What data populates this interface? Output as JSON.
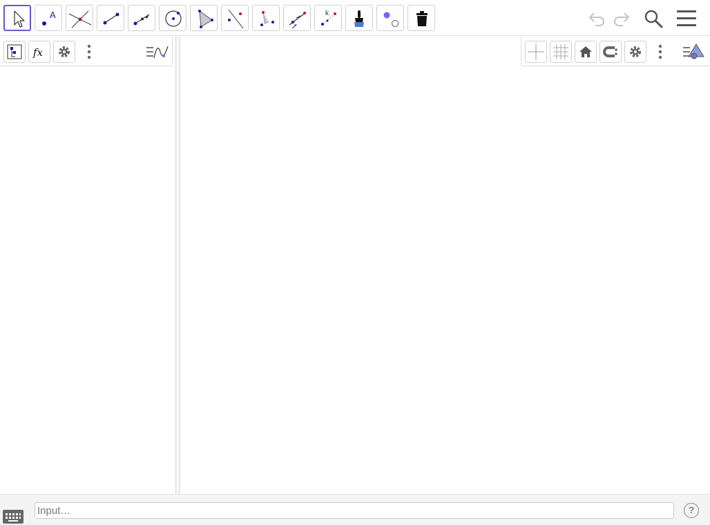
{
  "toolbar": {
    "tools": [
      {
        "name": "move-tool",
        "icon": "arrow-cursor-icon",
        "selected": true
      },
      {
        "name": "point-tool",
        "icon": "point-icon",
        "label": "A"
      },
      {
        "name": "intersect-tool",
        "icon": "intersect-icon"
      },
      {
        "name": "segment-tool",
        "icon": "segment-icon"
      },
      {
        "name": "perpendicular-tool",
        "icon": "perpendicular-icon"
      },
      {
        "name": "circle-tool",
        "icon": "circle-center-point-icon"
      },
      {
        "name": "polygon-tool",
        "icon": "polygon-icon"
      },
      {
        "name": "line-tool",
        "icon": "line-icon"
      },
      {
        "name": "angle-tool",
        "icon": "angle-icon"
      },
      {
        "name": "reflect-tool",
        "icon": "reflect-icon"
      },
      {
        "name": "text-slider-tool",
        "icon": "slider-icon",
        "label": "k"
      },
      {
        "name": "style-brush-tool",
        "icon": "paint-brush-icon"
      },
      {
        "name": "show-hide-tool",
        "icon": "show-hide-object-icon"
      },
      {
        "name": "delete-tool",
        "icon": "trash-icon"
      }
    ],
    "right_icons": [
      "undo-icon",
      "redo-icon",
      "search-icon",
      "hamburger-menu-icon"
    ]
  },
  "algebra": {
    "buttons": [
      "algebra-tree-icon",
      "fx-icon",
      "gear-icon",
      "more-vert-icon",
      "graph-style-icon"
    ],
    "fx_label": "fx"
  },
  "graphics": {
    "buttons": [
      "axes-icon",
      "grid-icon",
      "home-icon",
      "point-capture-icon",
      "gear-icon",
      "more-vert-icon",
      "graphics-style-icon"
    ]
  },
  "input": {
    "placeholder": "Input…",
    "value": "",
    "help_label": "?"
  },
  "colors": {
    "accent": "#6557d2",
    "point_blue": "#1a1aa6",
    "point_red": "#c0162c"
  }
}
